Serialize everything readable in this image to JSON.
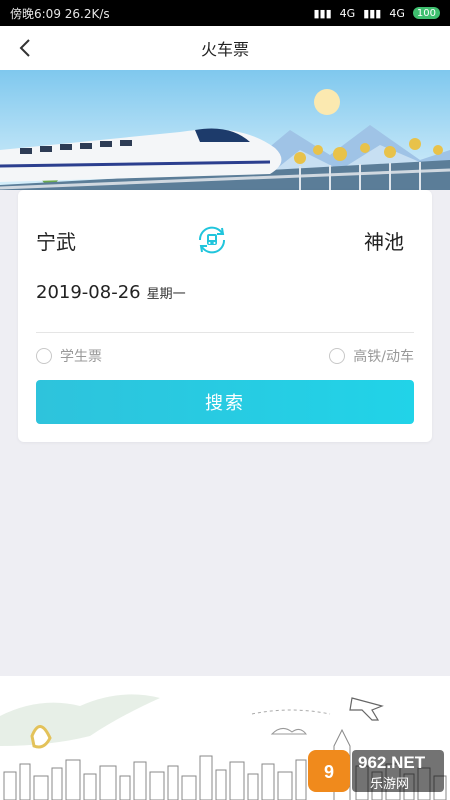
{
  "status_bar": {
    "left_text": "傍晚6:09  26.2K/s",
    "network_1": "4G",
    "network_2": "4G",
    "battery": "100"
  },
  "header": {
    "title": "火车票"
  },
  "search_card": {
    "from_station": "宁武",
    "to_station": "神池",
    "date": "2019-08-26",
    "weekday": "星期一",
    "options": {
      "student_ticket": "学生票",
      "high_speed": "高铁/动车"
    },
    "search_label": "搜索"
  },
  "watermark": {
    "brand": "962.NET",
    "subtitle": "乐游网"
  },
  "colors": {
    "accent": "#21d3e8",
    "page_bg": "#eeeef3"
  }
}
